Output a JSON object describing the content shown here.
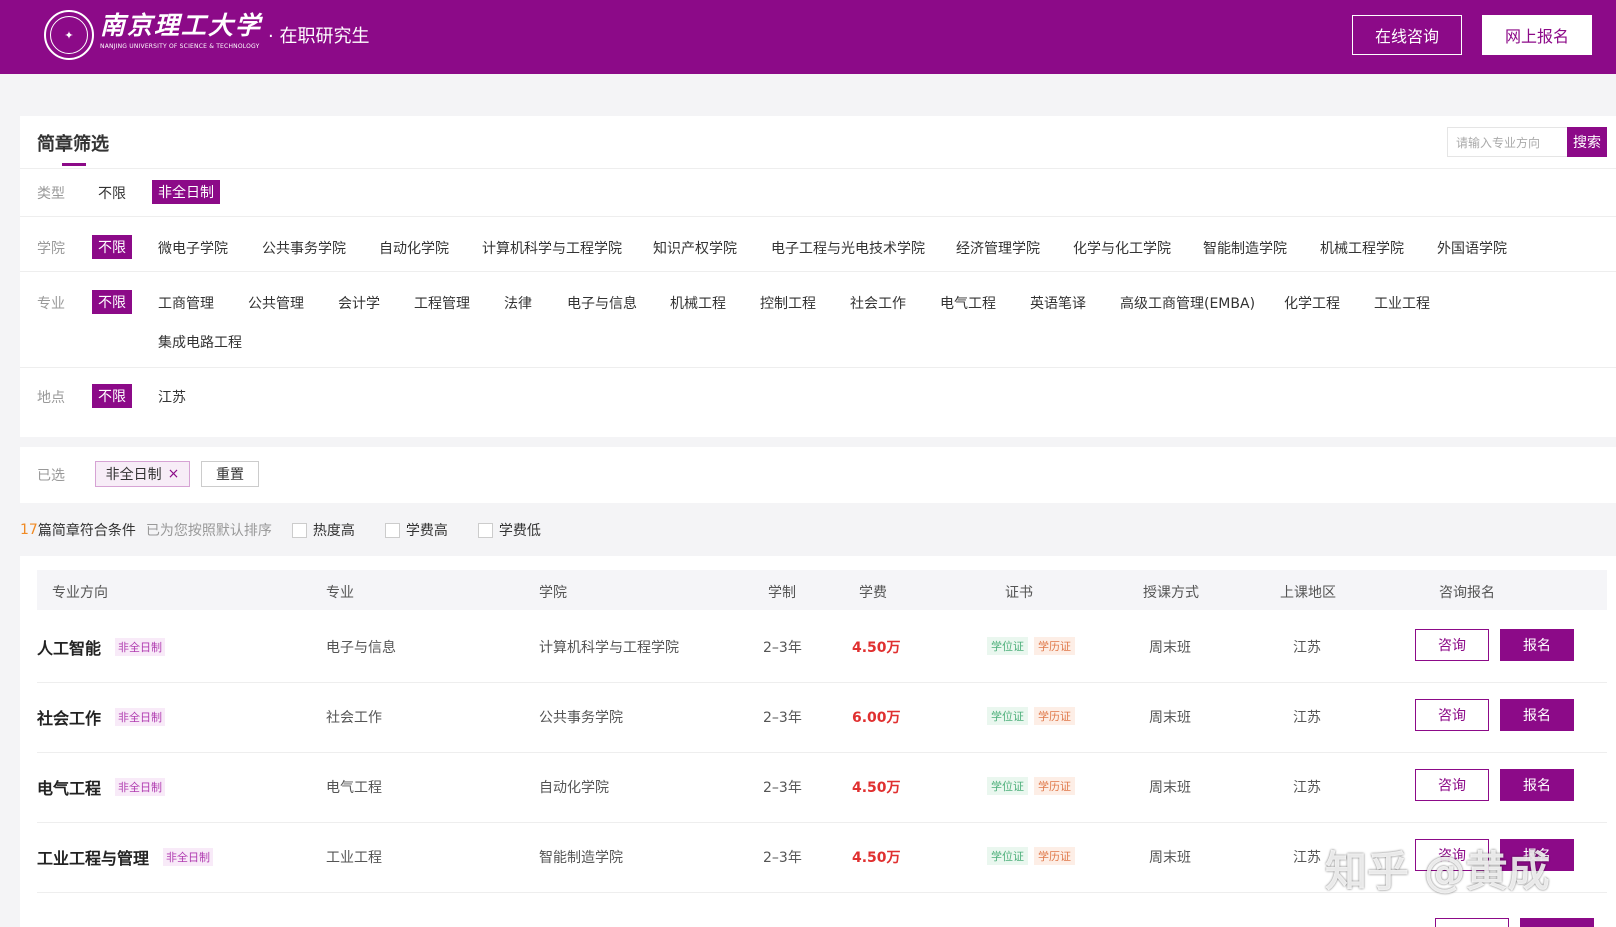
{
  "header": {
    "logo_seal": "南京理工大学",
    "brand_cn": "南京理工大学",
    "brand_en": "NANJING UNIVERSITY OF SCIENCE & TECHNOLOGY",
    "subtitle": "· 在职研究生",
    "consult_label": "在线咨询",
    "signup_label": "网上报名"
  },
  "filter": {
    "title": "简章筛选",
    "search_placeholder": "请输入专业方向",
    "search_label": "搜索",
    "type": {
      "label": "类型",
      "options": [
        "不限",
        "非全日制"
      ]
    },
    "college": {
      "label": "学院",
      "options": [
        "不限",
        "微电子学院",
        "公共事务学院",
        "自动化学院",
        "计算机科学与工程学院",
        "知识产权学院",
        "电子工程与光电技术学院",
        "经济管理学院",
        "化学与化工学院",
        "智能制造学院",
        "机械工程学院",
        "外国语学院"
      ]
    },
    "major": {
      "label": "专业",
      "options": [
        "不限",
        "工商管理",
        "公共管理",
        "会计学",
        "工程管理",
        "法律",
        "电子与信息",
        "机械工程",
        "控制工程",
        "社会工作",
        "电气工程",
        "英语笔译",
        "高级工商管理(EMBA)",
        "化学工程",
        "工业工程",
        "集成电路工程"
      ]
    },
    "location": {
      "label": "地点",
      "options": [
        "不限",
        "江苏"
      ]
    }
  },
  "selected": {
    "label": "已选",
    "tag": "非全日制",
    "tag_remove": "×",
    "reset_label": "重置"
  },
  "sort": {
    "count": "17",
    "count_suffix": "篇简章符合条件",
    "hint": "已为您按照默认排序",
    "options": [
      "热度高",
      "学费高",
      "学费低"
    ]
  },
  "table": {
    "headers": [
      "专业方向",
      "专业",
      "学院",
      "学制",
      "学费",
      "证书",
      "授课方式",
      "上课地区",
      "咨询报名"
    ],
    "consult_label": "咨询",
    "signup_label": "报名",
    "cert_degree": "学位证",
    "cert_edu": "学历证",
    "rows": [
      {
        "direction": "人工智能",
        "badge": "非全日制",
        "major": "电子与信息",
        "college": "计算机科学与工程学院",
        "years": "2–3年",
        "fee": "4.50万",
        "mode": "周末班",
        "region": "江苏"
      },
      {
        "direction": "社会工作",
        "badge": "非全日制",
        "major": "社会工作",
        "college": "公共事务学院",
        "years": "2–3年",
        "fee": "6.00万",
        "mode": "周末班",
        "region": "江苏"
      },
      {
        "direction": "电气工程",
        "badge": "非全日制",
        "major": "电气工程",
        "college": "自动化学院",
        "years": "2–3年",
        "fee": "4.50万",
        "mode": "周末班",
        "region": "江苏"
      },
      {
        "direction": "工业工程与管理",
        "badge": "非全日制",
        "major": "工业工程",
        "college": "智能制造学院",
        "years": "2–3年",
        "fee": "4.50万",
        "mode": "周末班",
        "region": "江苏"
      }
    ]
  },
  "watermark": "知乎 @黄成",
  "colors": {
    "brand": "#8c0a88",
    "fee": "#e03030",
    "count": "#f08a24"
  }
}
